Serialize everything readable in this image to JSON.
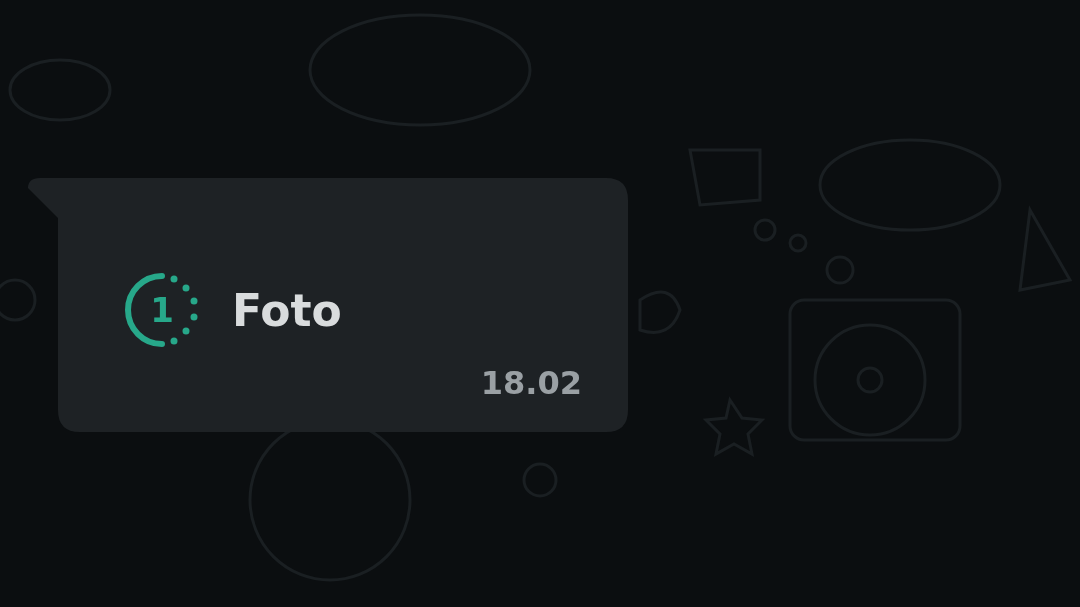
{
  "message": {
    "view_once_count": "1",
    "text": "Foto",
    "time": "18.02"
  }
}
